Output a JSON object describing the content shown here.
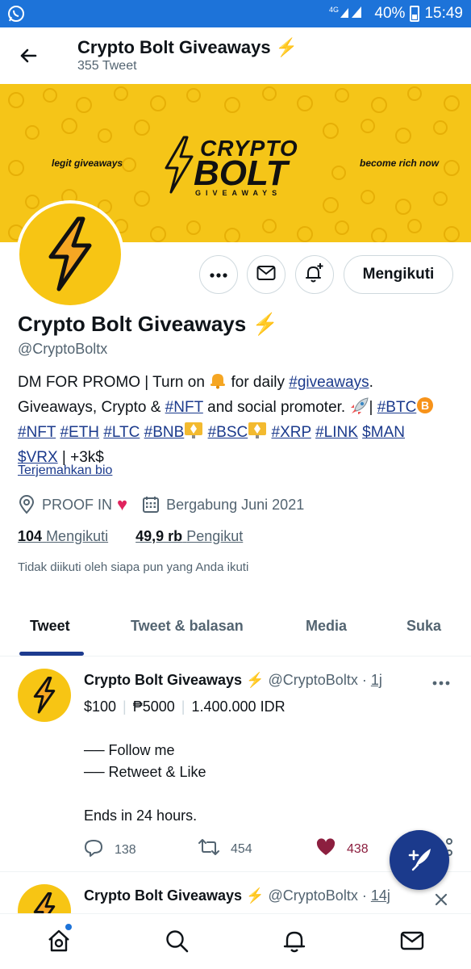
{
  "status_bar": {
    "battery": "40%",
    "time": "15:49",
    "network": "4G"
  },
  "header": {
    "title": "Crypto Bolt Giveaways",
    "subtitle": "355 Tweet"
  },
  "banner": {
    "left_text": "legit giveaways",
    "right_text": "become rich now",
    "logo_line1": "CRYPTO",
    "logo_line2": "BOLT",
    "logo_line3": "GIVEAWAYS"
  },
  "actions": {
    "follow_label": "Mengikuti"
  },
  "profile": {
    "name": "Crypto Bolt Giveaways",
    "handle": "@CryptoBoltx",
    "bio": {
      "l1_a": "DM FOR PROMO | Turn on ",
      "l1_b": " for daily ",
      "l1_tag": "#giveaways",
      "l1_c": ".",
      "l2_a": "Giveaways, Crypto & ",
      "l2_tag": "#NFT",
      "l2_b": " and social promoter. ",
      "l2_c": "| ",
      "l2_tag2": "#BTC",
      "l3_t1": "#NFT",
      "l3_t2": "#ETH",
      "l3_t3": "#LTC",
      "l3_t4": "#BNB",
      "l3_t5": "#BSC",
      "l3_t6": "#XRP",
      "l3_t7": "#LINK",
      "l3_t8": "$MAN",
      "l4_t1": "$VRX",
      "l4_b": " | +3k$"
    },
    "translate": "Terjemahkan bio",
    "location": "PROOF IN",
    "joined": "Bergabung Juni 2021",
    "following_count": "104",
    "following_label": "Mengikuti",
    "followers_count": "49,9 rb",
    "followers_label": "Pengikut",
    "not_followed": "Tidak diikuti oleh siapa pun yang Anda ikuti"
  },
  "tabs": [
    {
      "label": "Tweet",
      "active": true
    },
    {
      "label": "Tweet & balasan",
      "active": false
    },
    {
      "label": "Media",
      "active": false
    },
    {
      "label": "Suka",
      "active": false
    }
  ],
  "tweets": [
    {
      "name": "Crypto Bolt Giveaways",
      "handle": "@CryptoBoltx",
      "dot": "·",
      "time": "1j",
      "prize_1": "$100",
      "prize_2": "₱5000",
      "prize_3": "1.400.000 IDR",
      "line_follow": "── Follow me",
      "line_retweet": "── Retweet & Like",
      "line_ends": "Ends in 24 hours.",
      "replies": "138",
      "retweets": "454",
      "likes": "438"
    },
    {
      "name": "Crypto Bolt Giveaways",
      "handle": "@CryptoBoltx",
      "dot": "·",
      "time": "14j"
    }
  ],
  "icons": [
    "whatsapp-icon",
    "back-arrow-icon",
    "more-icon",
    "mail-icon",
    "bell-plus-icon",
    "location-icon",
    "calendar-icon",
    "reply-icon",
    "retweet-icon",
    "heart-icon",
    "share-icon",
    "compose-icon",
    "home-icon",
    "search-icon",
    "notifications-icon",
    "messages-icon"
  ],
  "colors": {
    "status_bar": "#1d73d9",
    "banner": "#f5c518",
    "link": "#1b3a8c",
    "fab": "#1b3a8c",
    "like": "#8c1f3f"
  }
}
